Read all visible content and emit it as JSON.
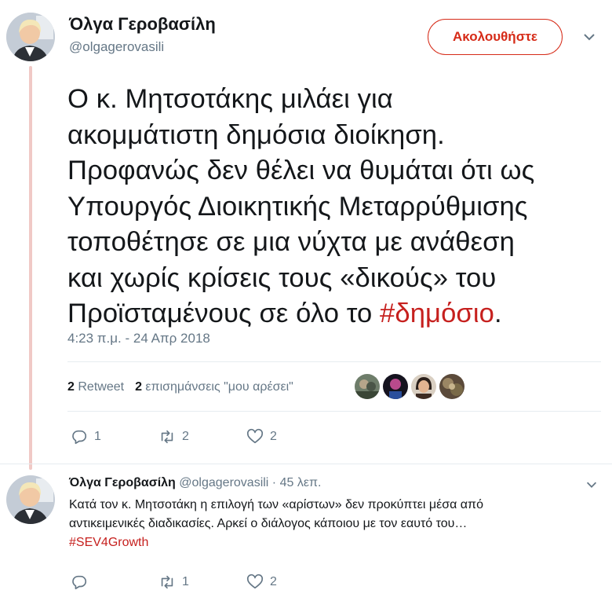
{
  "tweet": {
    "author_name": "Όλγα Γεροβασίλη",
    "author_handle": "@olgagerovasili",
    "follow_label": "Ακολουθήστε",
    "text_lines": [
      "Ο κ. Μητσοτάκης μιλάει για",
      "ακομμάτιστη δημόσια διοίκηση.",
      "Προφανώς δεν θέλει να θυμάται ότι ως",
      "Υπουργός Διοικητικής Μεταρρύθμισης",
      "τοποθέτησε σε μια νύχτα με ανάθεση",
      "και χωρίς κρίσεις τους «δικούς» του"
    ],
    "text_last_prefix": "Προϊσταμένους σε όλο το ",
    "hashtag": "#δημόσιο",
    "text_last_suffix": ".",
    "timestamp": "4:23 π.μ. - 24 Απρ 2018",
    "retweet_count": "2",
    "retweet_label": "Retweet",
    "like_count": "2",
    "like_label": "επισημάνσεις \"μου αρέσει\"",
    "actions": {
      "replies": "1",
      "retweets": "2",
      "likes": "2"
    }
  },
  "reply": {
    "author_name": "Όλγα Γεροβασίλη",
    "meta": "@olgagerovasili · 45 λεπ.",
    "line1": "Κατά τον κ. Μητσοτάκη η επιλογή των «αρίστων» δεν προκύπτει μέσα από",
    "line2": "αντικειμενικές διαδικασίες. Αρκεί ο διάλογος κάποιου με τον εαυτό του…",
    "hashtag": "#SEV4Growth",
    "actions": {
      "replies": "",
      "retweets": "1",
      "likes": "2"
    }
  },
  "colors": {
    "accent": "#d62b18",
    "hashtag": "#c6201e",
    "muted": "#657786",
    "thread": "#f0c9c6"
  },
  "icons": [
    "chevron-down-icon",
    "reply-icon",
    "retweet-icon",
    "like-icon"
  ]
}
